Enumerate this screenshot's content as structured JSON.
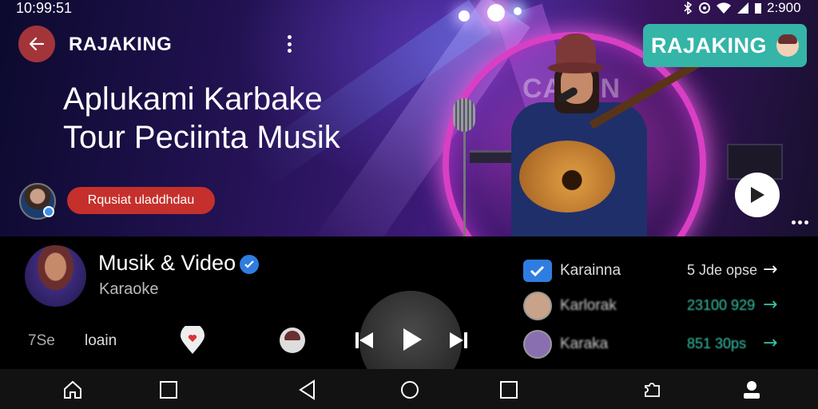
{
  "status_bar": {
    "time": "10:99:51",
    "right_text": "2:900"
  },
  "header": {
    "title": "RAJAKING",
    "hero_title_lines": [
      "Aplukami Karbake",
      "Tour Peciinta Musik"
    ],
    "pill_label": "Rqusiat uladdhdau",
    "brand_badge": "RAJAKING",
    "stage_sign": "CAB  IN"
  },
  "channel": {
    "name": "Musik & Video",
    "subtitle": "Karaoke",
    "verified": true
  },
  "controls": {
    "left_label": "7Se",
    "second_label": "loain"
  },
  "side_list": [
    {
      "label": "Karainna",
      "value": "5 Jde opse",
      "icon": "calendar-check-icon"
    },
    {
      "label": "Karlorak",
      "value": "23100 929",
      "icon": "avatar"
    },
    {
      "label": "Karaka",
      "value": "851 30ps",
      "icon": "avatar"
    }
  ],
  "icons": [
    "back-arrow-icon",
    "more-vertical-icon",
    "play-icon",
    "more-horizontal-icon",
    "heart-location-icon",
    "face-icon",
    "skip-previous-icon",
    "skip-next-icon",
    "home-icon",
    "square-icon",
    "triangle-back-icon",
    "circle-home-icon",
    "recents-icon",
    "puzzle-icon",
    "profile-icon"
  ],
  "colors": {
    "accent_red": "#c5302c",
    "brand_teal": "#34b5a8",
    "verified_blue": "#2f7de1",
    "list_teal": "#35c3a8"
  }
}
